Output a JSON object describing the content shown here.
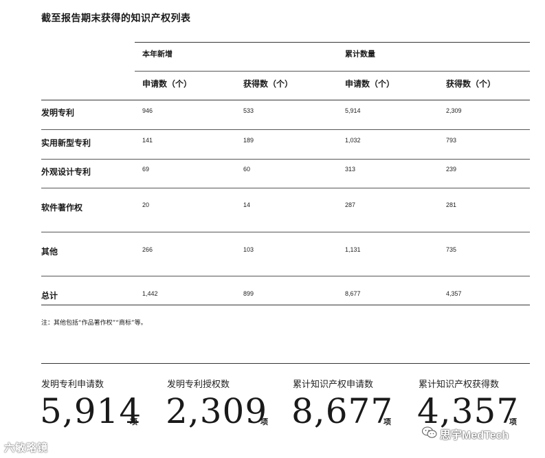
{
  "title": "截至报告期末获得的知识产权列表",
  "table": {
    "group_headers": [
      "本年新增",
      "累计数量"
    ],
    "sub_headers": [
      "申请数（个）",
      "获得数（个）",
      "申请数（个）",
      "获得数（个）"
    ],
    "rows": [
      {
        "label": "发明专利",
        "values": [
          "946",
          "533",
          "5,914",
          "2,309"
        ]
      },
      {
        "label": "实用新型专利",
        "values": [
          "141",
          "189",
          "1,032",
          "793"
        ]
      },
      {
        "label": "外观设计专利",
        "values": [
          "69",
          "60",
          "313",
          "239"
        ]
      },
      {
        "label": "软件著作权",
        "values": [
          "20",
          "14",
          "287",
          "281"
        ]
      },
      {
        "label": "其他",
        "values": [
          "266",
          "103",
          "1,131",
          "735"
        ]
      },
      {
        "label": "总计",
        "values": [
          "1,442",
          "899",
          "8,677",
          "4,357"
        ]
      }
    ]
  },
  "note": "注：其他包括“作品著作权”“商标”等。",
  "stats": [
    {
      "label": "发明专利申请数",
      "value": "5,914",
      "unit": "项"
    },
    {
      "label": "发明专利授权数",
      "value": "2,309",
      "unit": "项"
    },
    {
      "label": "累计知识产权申请数",
      "value": "8,677",
      "unit": "项"
    },
    {
      "label": "累计知识产权获得数",
      "value": "4,357",
      "unit": "项"
    }
  ],
  "watermarks": {
    "left": "六敏略镜",
    "right": "思宇MedTech",
    "right_icon": "wechat-icon"
  }
}
